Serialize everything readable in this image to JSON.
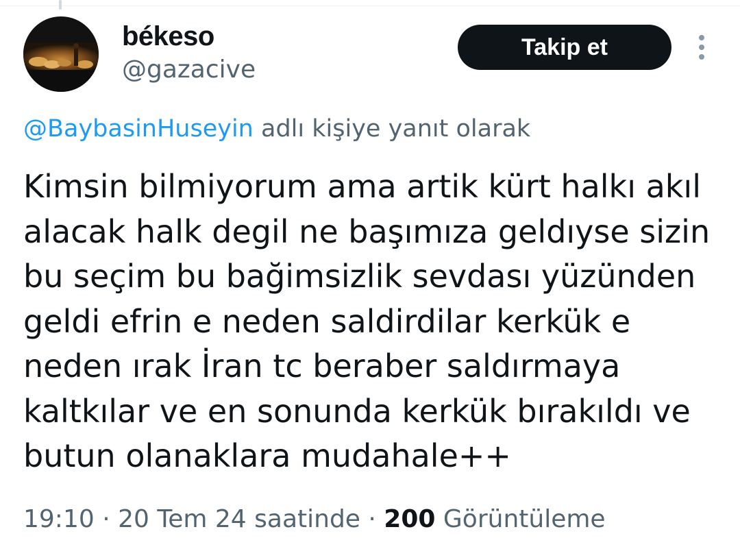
{
  "author": {
    "display_name": "békeso",
    "handle": "@gazacive",
    "avatar_icon": "painting-avatar-icon"
  },
  "actions": {
    "follow_label": "Takip et",
    "more_icon": "more-vertical-icon"
  },
  "reply": {
    "mention": "@BaybasinHuseyin",
    "suffix": "adlı kişiye yanıt olarak"
  },
  "tweet": {
    "lines": [
      "Kimsin bilmiyorum ama artik kürt halkı akıl",
      "alacak halk degil ne başımıza geldıyse sizin",
      "bu seçim bu bağimsizlik sevdası yüzünden",
      "geldi efrin e neden saldirdilar kerkük e",
      "neden ırak İran tc beraber saldırmaya",
      "kaltkılar ve en sonunda kerkük bırakıldı ve",
      "butun olanaklara mudahale++"
    ]
  },
  "meta": {
    "time": "19:10",
    "separator": " · ",
    "date": "20 Tem 24 saatinde",
    "views_count": "200",
    "views_label": "Görüntüleme"
  },
  "colors": {
    "text": "#0f1419",
    "secondary": "#536471",
    "link": "#1d9bf0",
    "button_bg": "#0f1419"
  }
}
